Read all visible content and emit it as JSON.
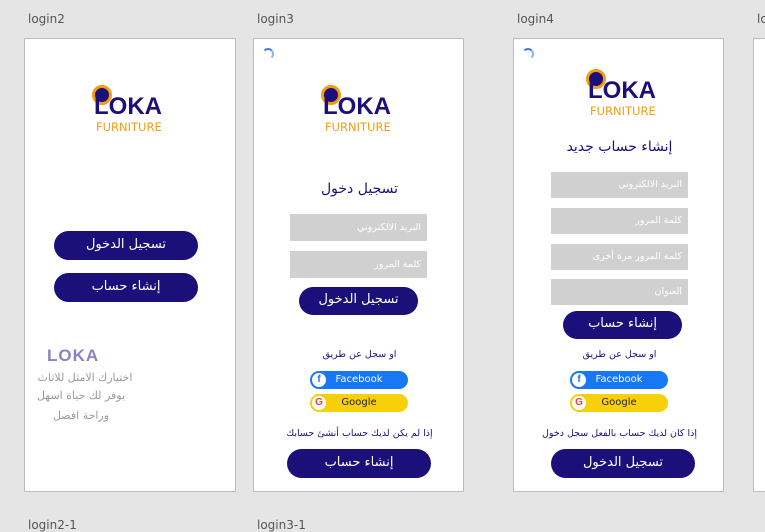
{
  "frames": [
    {
      "label": "login2"
    },
    {
      "label": "login3"
    },
    {
      "label": "login4"
    },
    {
      "label": "lo"
    }
  ],
  "bottom_labels": [
    "login2-1",
    "login3-1"
  ],
  "logo": {
    "word": "LOKA",
    "sub": "FURNITURE"
  },
  "login2": {
    "login_button": "تسجيل الدخول",
    "signup_button": "إنشاء حساب",
    "tag_logo": "LOKA",
    "tagline_1": "اختيارك الامثل للاثاث",
    "tagline_2": "يوفر لك حياة اسهل",
    "tagline_3": "وراحة افضل"
  },
  "login3": {
    "title": "تسجيل دخول",
    "email_placeholder": "البريد الالكتروني",
    "password_placeholder": "كلمة المرور",
    "login_button": "تسجيل الدخول",
    "or_text": "او سجل عن طريق",
    "facebook": "Facebook",
    "google": "Google",
    "no_account_text": "إذا لم يكن لديك حساب أنشئ حسابك",
    "signup_button": "إنشاء حساب"
  },
  "login4": {
    "title": "إنشاء حساب جديد",
    "email_placeholder": "البريد الالكتروني",
    "password_placeholder": "كلمة المرور",
    "confirm_placeholder": "كلمة المرور مرة أخرى",
    "address_placeholder": "العنوان",
    "signup_button": "إنشاء حساب",
    "or_text": "او سجل عن طريق",
    "facebook": "Facebook",
    "google": "Google",
    "have_account_text": "إذا كان لديك حساب بالفعل سجل دخول",
    "login_button": "تسجيل الدخول"
  },
  "colors": {
    "brand": "#1b0f7a",
    "accent": "#f39c12",
    "facebook": "#1877f2",
    "google": "#f7cf0a"
  }
}
